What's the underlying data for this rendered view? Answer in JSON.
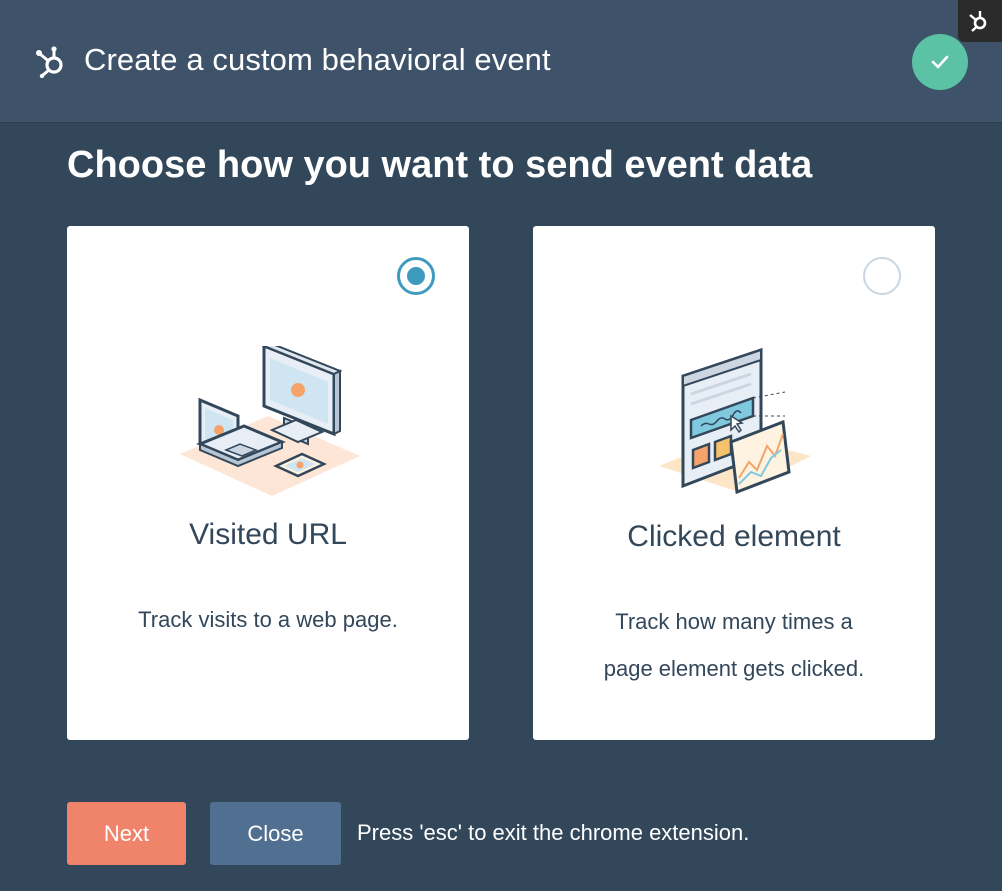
{
  "header": {
    "title": "Create a custom behavioral event",
    "brand_icon": "hubspot-sprocket-icon",
    "status_icon": "checkmark-icon",
    "status_color": "#5cc2a5",
    "corner_icon": "sprocket-icon"
  },
  "main": {
    "heading": "Choose how you want to send event data",
    "options": [
      {
        "title": "Visited URL",
        "description": "Track visits to a web page.",
        "selected": true,
        "illustration": "devices-illustration-icon"
      },
      {
        "title": "Clicked element",
        "description_lines": [
          "Track how many times a",
          "page element gets clicked."
        ],
        "selected": false,
        "illustration": "clicked-element-illustration-icon"
      }
    ]
  },
  "footer": {
    "next_label": "Next",
    "close_label": "Close",
    "hint": "Press 'esc' to exit the chrome extension."
  },
  "colors": {
    "background": "#33475b",
    "header": "#3e5269",
    "accent": "#3f9bbd",
    "next": "#f0846a",
    "close": "#516f90"
  }
}
